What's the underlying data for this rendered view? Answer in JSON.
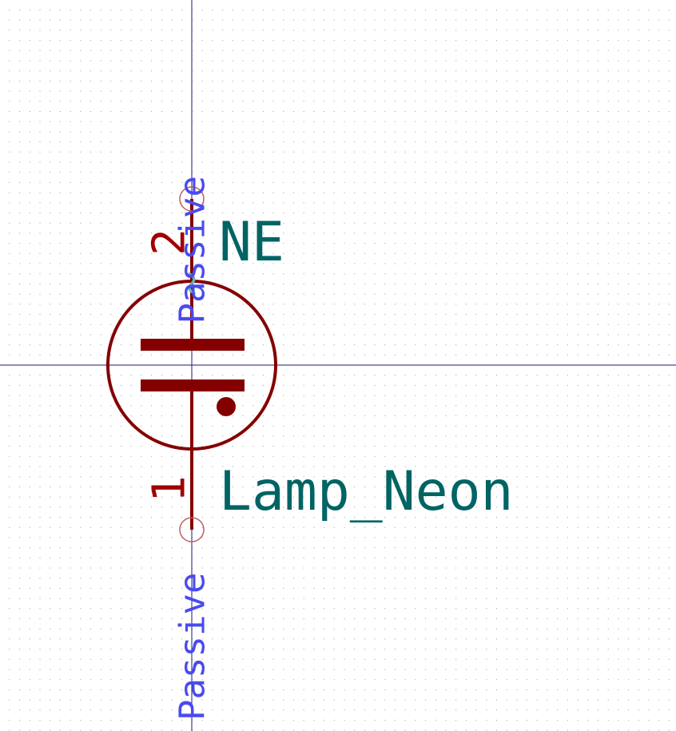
{
  "symbol": {
    "reference": "NE",
    "value": "Lamp_Neon"
  },
  "pins": [
    {
      "number": "2",
      "electrical_type": "Passive"
    },
    {
      "number": "1",
      "electrical_type": "Passive"
    }
  ],
  "colors": {
    "background": "#ffffff",
    "grid": "#9a9a9a",
    "crosshair": "#1a1a7a",
    "body": "#840000",
    "pin": "#840000",
    "pin_number": "#a00000",
    "pin_type": "#4a4af0",
    "field_text": "#006464",
    "unit_marker": "#5fb8b8",
    "pin_end": "#c06060"
  }
}
